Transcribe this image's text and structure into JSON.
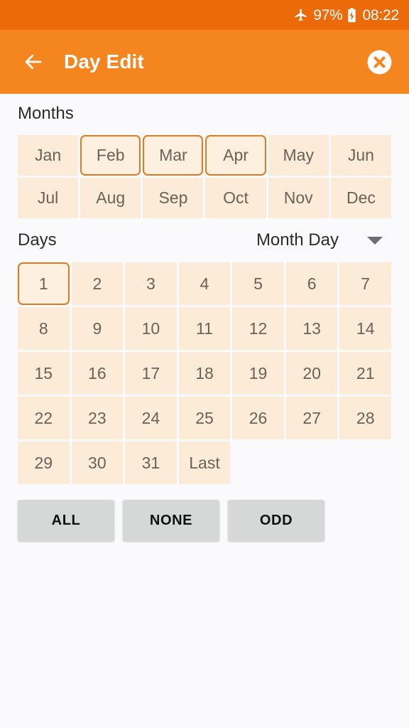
{
  "status_bar": {
    "airplane_icon": "airplane-mode-icon",
    "battery_percent": "97%",
    "battery_icon": "battery-charging-icon",
    "clock": "08:22",
    "background_color": "#EC6A08"
  },
  "toolbar": {
    "back_icon": "back-arrow-icon",
    "title": "Day Edit",
    "close_icon": "close-circle-icon",
    "background_color": "#F5861F"
  },
  "months_section": {
    "title": "Months",
    "items": [
      {
        "label": "Jan",
        "selected": false
      },
      {
        "label": "Feb",
        "selected": true
      },
      {
        "label": "Mar",
        "selected": true
      },
      {
        "label": "Apr",
        "selected": true
      },
      {
        "label": "May",
        "selected": false
      },
      {
        "label": "Jun",
        "selected": false
      },
      {
        "label": "Jul",
        "selected": false
      },
      {
        "label": "Aug",
        "selected": false
      },
      {
        "label": "Sep",
        "selected": false
      },
      {
        "label": "Oct",
        "selected": false
      },
      {
        "label": "Nov",
        "selected": false
      },
      {
        "label": "Dec",
        "selected": false
      }
    ]
  },
  "days_section": {
    "title": "Days",
    "mode_dropdown": {
      "selected": "Month Day",
      "caret_icon": "chevron-down-icon"
    },
    "items": [
      {
        "label": "1",
        "selected": true
      },
      {
        "label": "2",
        "selected": false
      },
      {
        "label": "3",
        "selected": false
      },
      {
        "label": "4",
        "selected": false
      },
      {
        "label": "5",
        "selected": false
      },
      {
        "label": "6",
        "selected": false
      },
      {
        "label": "7",
        "selected": false
      },
      {
        "label": "8",
        "selected": false
      },
      {
        "label": "9",
        "selected": false
      },
      {
        "label": "10",
        "selected": false
      },
      {
        "label": "11",
        "selected": false
      },
      {
        "label": "12",
        "selected": false
      },
      {
        "label": "13",
        "selected": false
      },
      {
        "label": "14",
        "selected": false
      },
      {
        "label": "15",
        "selected": false
      },
      {
        "label": "16",
        "selected": false
      },
      {
        "label": "17",
        "selected": false
      },
      {
        "label": "18",
        "selected": false
      },
      {
        "label": "19",
        "selected": false
      },
      {
        "label": "20",
        "selected": false
      },
      {
        "label": "21",
        "selected": false
      },
      {
        "label": "22",
        "selected": false
      },
      {
        "label": "23",
        "selected": false
      },
      {
        "label": "24",
        "selected": false
      },
      {
        "label": "25",
        "selected": false
      },
      {
        "label": "26",
        "selected": false
      },
      {
        "label": "27",
        "selected": false
      },
      {
        "label": "28",
        "selected": false
      },
      {
        "label": "29",
        "selected": false
      },
      {
        "label": "30",
        "selected": false
      },
      {
        "label": "31",
        "selected": false
      },
      {
        "label": "Last",
        "selected": false
      }
    ]
  },
  "actions": {
    "all_label": "ALL",
    "none_label": "NONE",
    "odd_label": "ODD"
  },
  "colors": {
    "accent": "#F5861F",
    "status_bar": "#EC6A08",
    "cell_fill": "#FCEBD6",
    "cell_selected_border": "#E07A1E",
    "cell_text": "#6B6257",
    "button_fill": "#D6D7D7",
    "page_background": "#FAFAFC"
  }
}
